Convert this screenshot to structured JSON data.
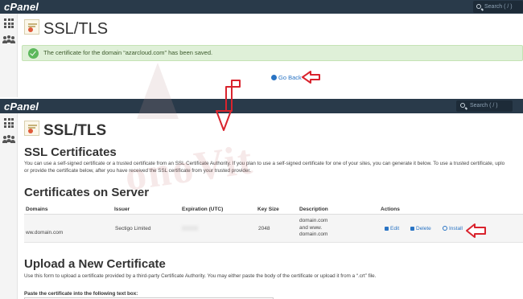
{
  "app": {
    "logo": "cPanel",
    "search_placeholder": "Search ( / )"
  },
  "top_screen": {
    "page_title": "SSL/TLS",
    "alert_message": "The certificate for the domain “azarcloud.com” has been saved.",
    "go_back_label": "Go Back"
  },
  "bottom_screen": {
    "page_title": "SSL/TLS",
    "ssl_heading": "SSL Certificates",
    "ssl_paragraph_line1": "You can use a self-signed certificate or a trusted certificate from an SSL Certificate Authority. If you plan to use a self-signed certificate for one of your sites, you can generate it below. To use a trusted certificate, uplo",
    "ssl_paragraph_line2": "or provide the certificate below, after you have received the SSL certificate from your trusted provider.",
    "certs_heading": "Certificates on Server",
    "table": {
      "columns": [
        "Domains",
        "Issuer",
        "Expiration (UTC)",
        "Key Size",
        "Description",
        "Actions"
      ],
      "row": {
        "domain": "ww.domain.com",
        "issuer": "Sectigo Limited",
        "key_size": "2048",
        "description_lines": [
          "domain.com",
          "and www.",
          "domain.com"
        ],
        "actions": [
          "Edit",
          "Delete",
          "Install"
        ]
      }
    },
    "upload_heading": "Upload a New Certificate",
    "upload_paragraph": "Use this form to upload a certificate provided by a third-party Certificate Authority. You may either paste the body of the certificate or upload it from a “.crt” file.",
    "paste_label": "Paste the certificate into the following text box:"
  },
  "watermark_text": "onoVit",
  "colors": {
    "header_bg": "#293a4a",
    "link_blue": "#2a74c4",
    "success_bg": "#dff0d8",
    "annotation_red": "#d9232d"
  }
}
